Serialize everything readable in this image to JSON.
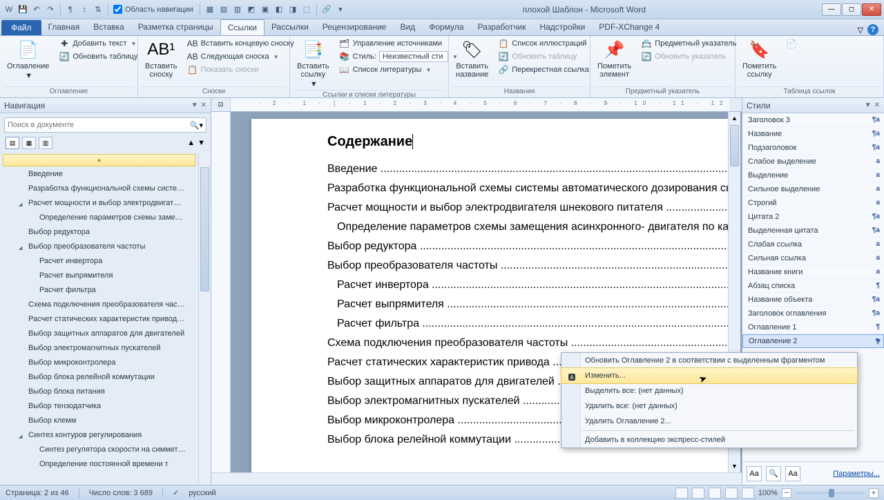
{
  "window": {
    "title": "плохой Шаблон - Microsoft Word"
  },
  "qat": {
    "nav_area": "Область навигации"
  },
  "tabs": {
    "file": "Файл",
    "items": [
      "Главная",
      "Вставка",
      "Разметка страницы",
      "Ссылки",
      "Рассылки",
      "Рецензирование",
      "Вид",
      "Формула",
      "Разработчик",
      "Надстройки",
      "PDF-XChange 4"
    ],
    "active_index": 3
  },
  "ribbon": {
    "g1": {
      "label": "Оглавление",
      "toc": "Оглавление",
      "add_text": "Добавить текст",
      "update_table": "Обновить таблицу"
    },
    "g2": {
      "label": "Сноски",
      "insert_fn": "Вставить\nсноску",
      "end_fn": "Вставить концевую сноску",
      "next_fn": "Следующая сноска",
      "show_notes": "Показать сноски"
    },
    "g3": {
      "label": "Ссылки и списки литературы",
      "insert_link": "Вставить\nссылку",
      "manage": "Управление источниками",
      "style_lbl": "Стиль:",
      "style_val": "Неизвестный сти",
      "biblio": "Список литературы"
    },
    "g4": {
      "label": "Названия",
      "insert_name": "Вставить\nназвание",
      "list_ill": "Список иллюстраций",
      "update_tbl": "Обновить таблицу",
      "cross": "Перекрестная ссылка"
    },
    "g5": {
      "label": "Предметный указатель",
      "mark": "Пометить\nэлемент",
      "index": "Предметный указатель",
      "upd_idx": "Обновить указатель"
    },
    "g6": {
      "label": "Таблица ссылок",
      "mark_link": "Пометить\nссылку"
    }
  },
  "nav": {
    "title": "Навигация",
    "search_placeholder": "Поиск в документе",
    "items": [
      {
        "t": "Введение",
        "l": 1
      },
      {
        "t": "Разработка функциональной схемы систе…",
        "l": 1
      },
      {
        "t": "Расчет мощности и выбор электродвигат…",
        "l": 1,
        "ch": true
      },
      {
        "t": "Определение параметров схемы заме…",
        "l": 2
      },
      {
        "t": "Выбор редуктора",
        "l": 1
      },
      {
        "t": "Выбор преобразователя частоты",
        "l": 1,
        "ch": true
      },
      {
        "t": "Расчет инвертора",
        "l": 2
      },
      {
        "t": "Расчет выпрямителя",
        "l": 2
      },
      {
        "t": "Расчет фильтра",
        "l": 2
      },
      {
        "t": "Схема подключения преобразователя час…",
        "l": 1
      },
      {
        "t": "Расчет статических характеристик привод…",
        "l": 1
      },
      {
        "t": "Выбор защитных аппаратов для двигателей",
        "l": 1
      },
      {
        "t": "Выбор электромагнитных пускателей",
        "l": 1
      },
      {
        "t": "Выбор микроконтролера",
        "l": 1
      },
      {
        "t": "Выбор блока релейной коммутации",
        "l": 1
      },
      {
        "t": "Выбор блока питания",
        "l": 1
      },
      {
        "t": "Выбор тензодатчика",
        "l": 1
      },
      {
        "t": "Выбор клемм",
        "l": 1
      },
      {
        "t": "Синтез контуров регулирования",
        "l": 1,
        "ch": true
      },
      {
        "t": "Синтез регулятора скорости на симмет…",
        "l": 2
      },
      {
        "t": "Определение постоянной времени т",
        "l": 2
      }
    ]
  },
  "doc": {
    "heading": "Содержание",
    "toc": [
      {
        "t": "Введение",
        "l": 1
      },
      {
        "t": "Разработка функциональной схемы системы автоматического дозирования сыпучих материалов",
        "l": 1,
        "wrap": true
      },
      {
        "t": "Расчет мощности и выбор электродвигателя шнекового питателя",
        "l": 1
      },
      {
        "t": "Определение параметров схемы замещения асинхронного- двигателя по каталожным данным",
        "l": 2,
        "wrap": true
      },
      {
        "t": "Выбор редуктора",
        "l": 1
      },
      {
        "t": "Выбор преобразователя частоты",
        "l": 1
      },
      {
        "t": "Расчет инвертора",
        "l": 2
      },
      {
        "t": "Расчет выпрямителя",
        "l": 2
      },
      {
        "t": "Расчет фильтра",
        "l": 2
      },
      {
        "t": "Схема подключения преобразователя частоты",
        "l": 1
      },
      {
        "t": "Расчет статических характеристик привода",
        "l": 1
      },
      {
        "t": "Выбор защитных аппаратов для двигателей",
        "l": 1
      },
      {
        "t": "Выбор электромагнитных пускателей",
        "l": 1
      },
      {
        "t": "Выбор микроконтролера",
        "l": 1
      },
      {
        "t": "Выбор блока релейной коммутации",
        "l": 1
      }
    ]
  },
  "styles": {
    "title": "Стили",
    "items": [
      {
        "n": "Заголовок 3",
        "m": "¶a"
      },
      {
        "n": "Название",
        "m": "¶a"
      },
      {
        "n": "Подзаголовок",
        "m": "¶a"
      },
      {
        "n": "Слабое выделение",
        "m": "a"
      },
      {
        "n": "Выделение",
        "m": "a"
      },
      {
        "n": "Сильное выделение",
        "m": "a"
      },
      {
        "n": "Строгий",
        "m": "a"
      },
      {
        "n": "Цитата 2",
        "m": "¶a"
      },
      {
        "n": "Выделенная цитата",
        "m": "¶a"
      },
      {
        "n": "Слабая ссылка",
        "m": "a"
      },
      {
        "n": "Сильная ссылка",
        "m": "a"
      },
      {
        "n": "Название книги",
        "m": "a"
      },
      {
        "n": "Абзац списка",
        "m": "¶"
      },
      {
        "n": "Название объекта",
        "m": "¶a"
      },
      {
        "n": "Заголовок оглавления",
        "m": "¶a"
      },
      {
        "n": "Оглавление 1",
        "m": "¶"
      },
      {
        "n": "Оглавление 2",
        "m": "¶",
        "sel": true
      }
    ],
    "params": "Параметры..."
  },
  "context": {
    "i1": "Обновить Оглавление 2 в соответствии с выделенным фрагментом",
    "i2": "Изменить...",
    "i3": "Выделить все: (нет данных)",
    "i4": "Удалить все: (нет данных)",
    "i5": "Удалить Оглавление 2...",
    "i6": "Добавить в коллекцию экспресс-стилей"
  },
  "status": {
    "page": "Страница: 2 из 46",
    "words": "Число слов: 3 689",
    "lang": "русский",
    "zoom": "100%"
  }
}
